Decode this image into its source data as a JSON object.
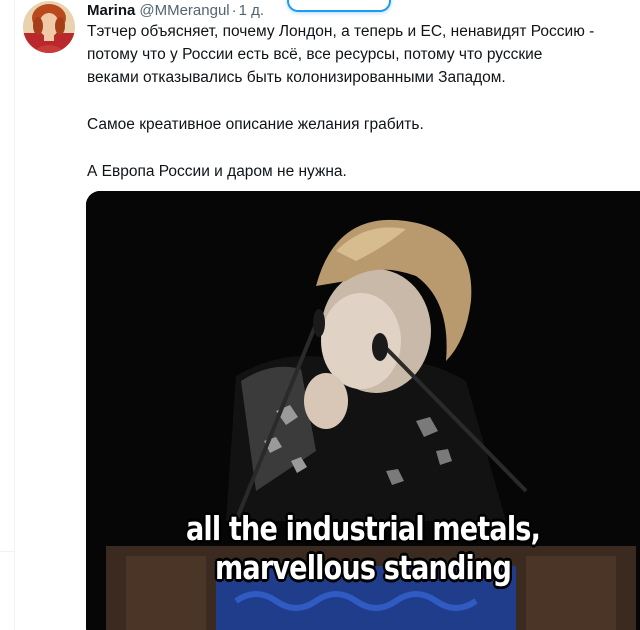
{
  "tweet": {
    "author_name": "Marina",
    "author_handle": "@MMerangul",
    "separator": "·",
    "time": "1 д.",
    "text_lines": [
      "Тэтчер объясняет, почему Лондон, а теперь и ЕС, ненавидят Россию -",
      "потому что у России есть всё, все ресурсы,  потому что русские",
      "веками отказывались быть колонизированными Западом.",
      "Самое креативное описание желания грабить.",
      "А Европа России и даром не нужна."
    ]
  },
  "media": {
    "type": "video",
    "subtitle_lines": [
      "all the industrial metals,",
      "marvellous standing"
    ]
  },
  "colors": {
    "text_primary": "#0f1419",
    "text_secondary": "#536471",
    "accent": "#1d9bf0",
    "divider": "#eff3f4"
  }
}
